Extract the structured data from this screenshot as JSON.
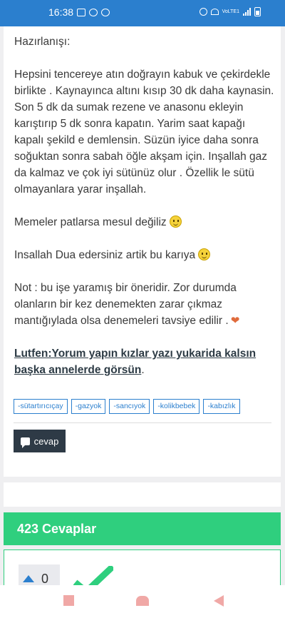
{
  "status_bar": {
    "time": "16:38",
    "volte": "VoLTE1"
  },
  "post": {
    "heading": "Hazırlanışı:",
    "paragraph_1": "Hepsini tencereye atın doğrayın kabuk ve çekirdekle birlikte . Kaynayınca altını kısıp 30 dk daha kaynasin. Son 5 dk da sumak rezene ve anasonu ekleyin karıştırıp 5 dk sonra kapatın.  Yarim saat kapağı kapalı şekild e demlensin.  Süzün iyice daha sonra soğuktan sonra sabah öğle akşam için.  Inşallah gaz da kalmaz ve çok iyi sütünüz olur .  Özellik le sütü olmayanlara yarar inşallah.",
    "paragraph_2": "Memeler patlarsa mesul değiliz",
    "paragraph_3": "Insallah Dua edersiniz artik bu karıya",
    "paragraph_4": "Not : bu işe yaramış bir öneridir.  Zor durumda olanların bir kez denemekten zarar çıkmaz mantığıylada olsa denemeleri tavsiye edilir .",
    "bold_link": "Lutfen:Yorum yapın kızlar yazı yukarida kalsın başka annelerde görsün",
    "bold_link_suffix": ".",
    "tags": [
      "-sütartırıcıçay",
      "-gazyok",
      "-sancıyok",
      "-kolikbebek",
      "-kabızlık"
    ],
    "reply_label": "cevap"
  },
  "answers": {
    "header": "423 Cevaplar"
  },
  "answer_1": {
    "votes": "0"
  },
  "colors": {
    "primary": "#2b7fce",
    "accent_green": "#2fcf7e",
    "dark_button": "#2e3a46"
  }
}
